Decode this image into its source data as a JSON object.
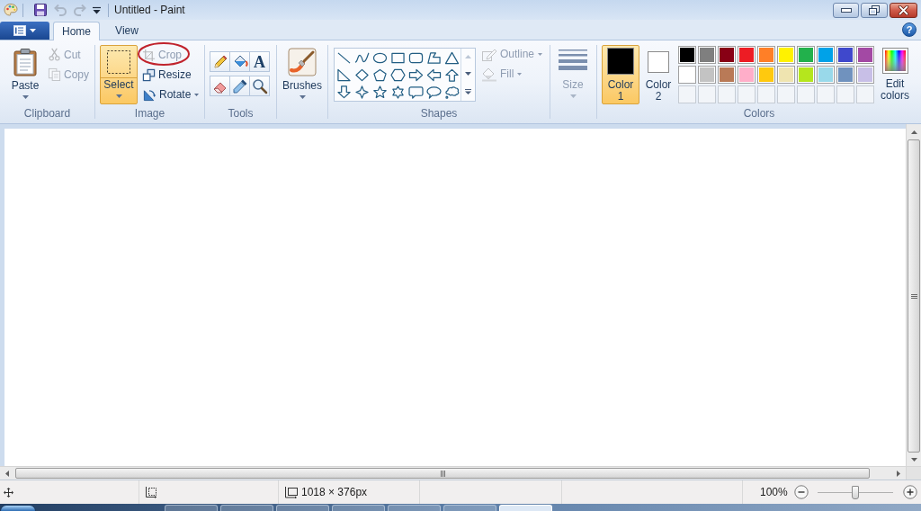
{
  "title_bar": {
    "title": "Untitled - Paint",
    "quick_access": [
      {
        "kind": "save",
        "disabled": false
      },
      {
        "kind": "undo",
        "disabled": true
      },
      {
        "kind": "redo",
        "disabled": true
      }
    ]
  },
  "tabs": [
    {
      "label": "Home",
      "selected": true
    },
    {
      "label": "View",
      "selected": false
    }
  ],
  "help": {
    "glyph": "?"
  },
  "clipboard": {
    "label": "Clipboard",
    "paste": {
      "label": "Paste"
    },
    "items": [
      {
        "label": "Cut",
        "disabled": true
      },
      {
        "label": "Copy",
        "disabled": true
      }
    ]
  },
  "image": {
    "label": "Image",
    "select": {
      "label": "Select",
      "selected": true
    },
    "items": [
      {
        "label": "Crop",
        "disabled": true,
        "highlighted": true,
        "dropdown": false
      },
      {
        "label": "Resize",
        "disabled": false,
        "highlighted": false,
        "dropdown": false
      },
      {
        "label": "Rotate",
        "disabled": false,
        "highlighted": false,
        "dropdown": true
      }
    ]
  },
  "tools": {
    "label": "Tools",
    "text_tool": "A"
  },
  "brushes": {
    "label": "Brushes"
  },
  "shapes": {
    "label": "Shapes",
    "gallery_scroll": [
      {
        "kind": "up",
        "disabled": true
      },
      {
        "kind": "down",
        "disabled": false
      },
      {
        "kind": "more",
        "disabled": false
      }
    ],
    "outline": {
      "label": "Outline",
      "disabled": true
    },
    "fill": {
      "label": "Fill",
      "disabled": true
    }
  },
  "size": {
    "label": "Size",
    "disabled": true
  },
  "colors": {
    "label": "Colors",
    "color_1": {
      "label": "Color 1",
      "selected": true,
      "color": "#000000"
    },
    "color_2": {
      "label": "Color 2",
      "selected": false,
      "color": "#ffffff"
    },
    "palette": [
      {
        "kind": "swatch",
        "color": "#000000"
      },
      {
        "kind": "swatch",
        "color": "#7f7f7f"
      },
      {
        "kind": "swatch",
        "color": "#880015"
      },
      {
        "kind": "swatch",
        "color": "#ed1c24"
      },
      {
        "kind": "swatch",
        "color": "#ff7f27"
      },
      {
        "kind": "swatch",
        "color": "#fff200"
      },
      {
        "kind": "swatch",
        "color": "#22b14c"
      },
      {
        "kind": "swatch",
        "color": "#00a2e8"
      },
      {
        "kind": "swatch",
        "color": "#3f48cc"
      },
      {
        "kind": "swatch",
        "color": "#a349a4"
      },
      {
        "kind": "swatch",
        "color": "#ffffff"
      },
      {
        "kind": "swatch",
        "color": "#c3c3c3"
      },
      {
        "kind": "swatch",
        "color": "#b97a57"
      },
      {
        "kind": "swatch",
        "color": "#ffaec9"
      },
      {
        "kind": "swatch",
        "color": "#ffc90e"
      },
      {
        "kind": "swatch",
        "color": "#efe4b0"
      },
      {
        "kind": "swatch",
        "color": "#b5e61d"
      },
      {
        "kind": "swatch",
        "color": "#99d9ea"
      },
      {
        "kind": "swatch",
        "color": "#7092be"
      },
      {
        "kind": "swatch",
        "color": "#c8bfe7"
      },
      {
        "kind": "empty"
      },
      {
        "kind": "empty"
      },
      {
        "kind": "empty"
      },
      {
        "kind": "empty"
      },
      {
        "kind": "empty"
      },
      {
        "kind": "empty"
      },
      {
        "kind": "empty"
      },
      {
        "kind": "empty"
      },
      {
        "kind": "empty"
      },
      {
        "kind": "empty"
      }
    ],
    "edit": {
      "label": "Edit colors"
    }
  },
  "status_bar": {
    "canvas_size": "1018 × 376px",
    "zoom": "100%",
    "zoom_slider": {
      "level": 0.5
    }
  },
  "taskbar": {
    "buttons": [
      {
        "selected": false
      },
      {
        "selected": false
      },
      {
        "selected": false
      },
      {
        "selected": false
      },
      {
        "selected": false
      },
      {
        "selected": false
      },
      {
        "selected": true
      }
    ]
  }
}
